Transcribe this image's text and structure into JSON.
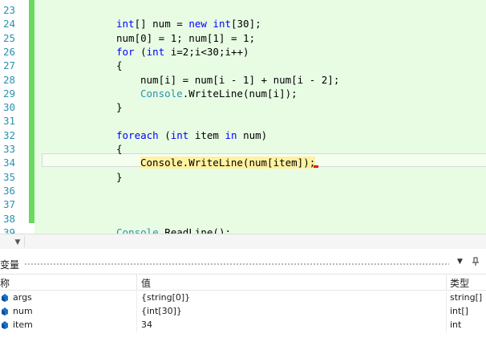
{
  "editor": {
    "lines": [
      {
        "num": "23",
        "indent": 0,
        "tokens": []
      },
      {
        "num": "24",
        "indent": 0,
        "tokens": [
          {
            "t": "int",
            "c": "kw"
          },
          {
            "t": "[] num = ",
            "c": ""
          },
          {
            "t": "new",
            "c": "kw"
          },
          {
            "t": " ",
            "c": ""
          },
          {
            "t": "int",
            "c": "kw"
          },
          {
            "t": "[30];",
            "c": ""
          }
        ]
      },
      {
        "num": "25",
        "indent": 0,
        "tokens": [
          {
            "t": "num[0] = 1; num[1] = 1;",
            "c": ""
          }
        ]
      },
      {
        "num": "26",
        "indent": 0,
        "tokens": [
          {
            "t": "for",
            "c": "kw"
          },
          {
            "t": " (",
            "c": ""
          },
          {
            "t": "int",
            "c": "kw"
          },
          {
            "t": " i=2;i<30;i++)",
            "c": ""
          }
        ]
      },
      {
        "num": "27",
        "indent": 0,
        "tokens": [
          {
            "t": "{",
            "c": ""
          }
        ]
      },
      {
        "num": "28",
        "indent": 1,
        "tokens": [
          {
            "t": "num[i] = num[i - 1] + num[i - 2];",
            "c": ""
          }
        ]
      },
      {
        "num": "29",
        "indent": 1,
        "tokens": [
          {
            "t": "Console",
            "c": "ty"
          },
          {
            "t": ".WriteLine(num[i]);",
            "c": ""
          }
        ]
      },
      {
        "num": "30",
        "indent": 0,
        "tokens": [
          {
            "t": "}",
            "c": ""
          }
        ]
      },
      {
        "num": "31",
        "indent": 0,
        "tokens": []
      },
      {
        "num": "32",
        "indent": 0,
        "tokens": [
          {
            "t": "foreach",
            "c": "kw"
          },
          {
            "t": " (",
            "c": ""
          },
          {
            "t": "int",
            "c": "kw"
          },
          {
            "t": " item ",
            "c": ""
          },
          {
            "t": "in",
            "c": "kw"
          },
          {
            "t": " num)",
            "c": ""
          }
        ]
      },
      {
        "num": "33",
        "indent": 0,
        "tokens": [
          {
            "t": "{",
            "c": ""
          }
        ]
      },
      {
        "num": "34",
        "indent": 1,
        "tokens": [
          {
            "t": "Console.WriteLine(num[item]);",
            "c": "hl"
          }
        ]
      },
      {
        "num": "35",
        "indent": 0,
        "tokens": [
          {
            "t": "}",
            "c": ""
          }
        ]
      },
      {
        "num": "36",
        "indent": 0,
        "tokens": []
      },
      {
        "num": "37",
        "indent": 0,
        "tokens": []
      },
      {
        "num": "38",
        "indent": 0,
        "tokens": []
      },
      {
        "num": "39",
        "indent": 0,
        "tokens": [
          {
            "t": "Console",
            "c": "ty"
          },
          {
            "t": ".ReadLine();",
            "c": ""
          }
        ]
      }
    ]
  },
  "hscroll": {
    "dropdown_icon": "chevron-down-icon"
  },
  "variables_panel": {
    "title": "变量",
    "columns": {
      "name": "称",
      "value": "值",
      "type": "类型"
    },
    "rows": [
      {
        "name": "args",
        "value": "{string[0]}",
        "type": "string[]"
      },
      {
        "name": "num",
        "value": "{int[30]}",
        "type": "int[]"
      },
      {
        "name": "item",
        "value": "34",
        "type": "int"
      }
    ],
    "icons": {
      "dropdown": "chevron-down-icon",
      "pin": "pin-icon",
      "variable": "variable-icon"
    }
  },
  "colors": {
    "editor_background": "#e8fce4",
    "change_margin": "#6bd862",
    "line_number": "#2b91af",
    "keyword": "#0000ff",
    "type_name": "#2b91af",
    "current_statement_highlight": "#fff2a0",
    "error_squiggle": "#e51400"
  }
}
